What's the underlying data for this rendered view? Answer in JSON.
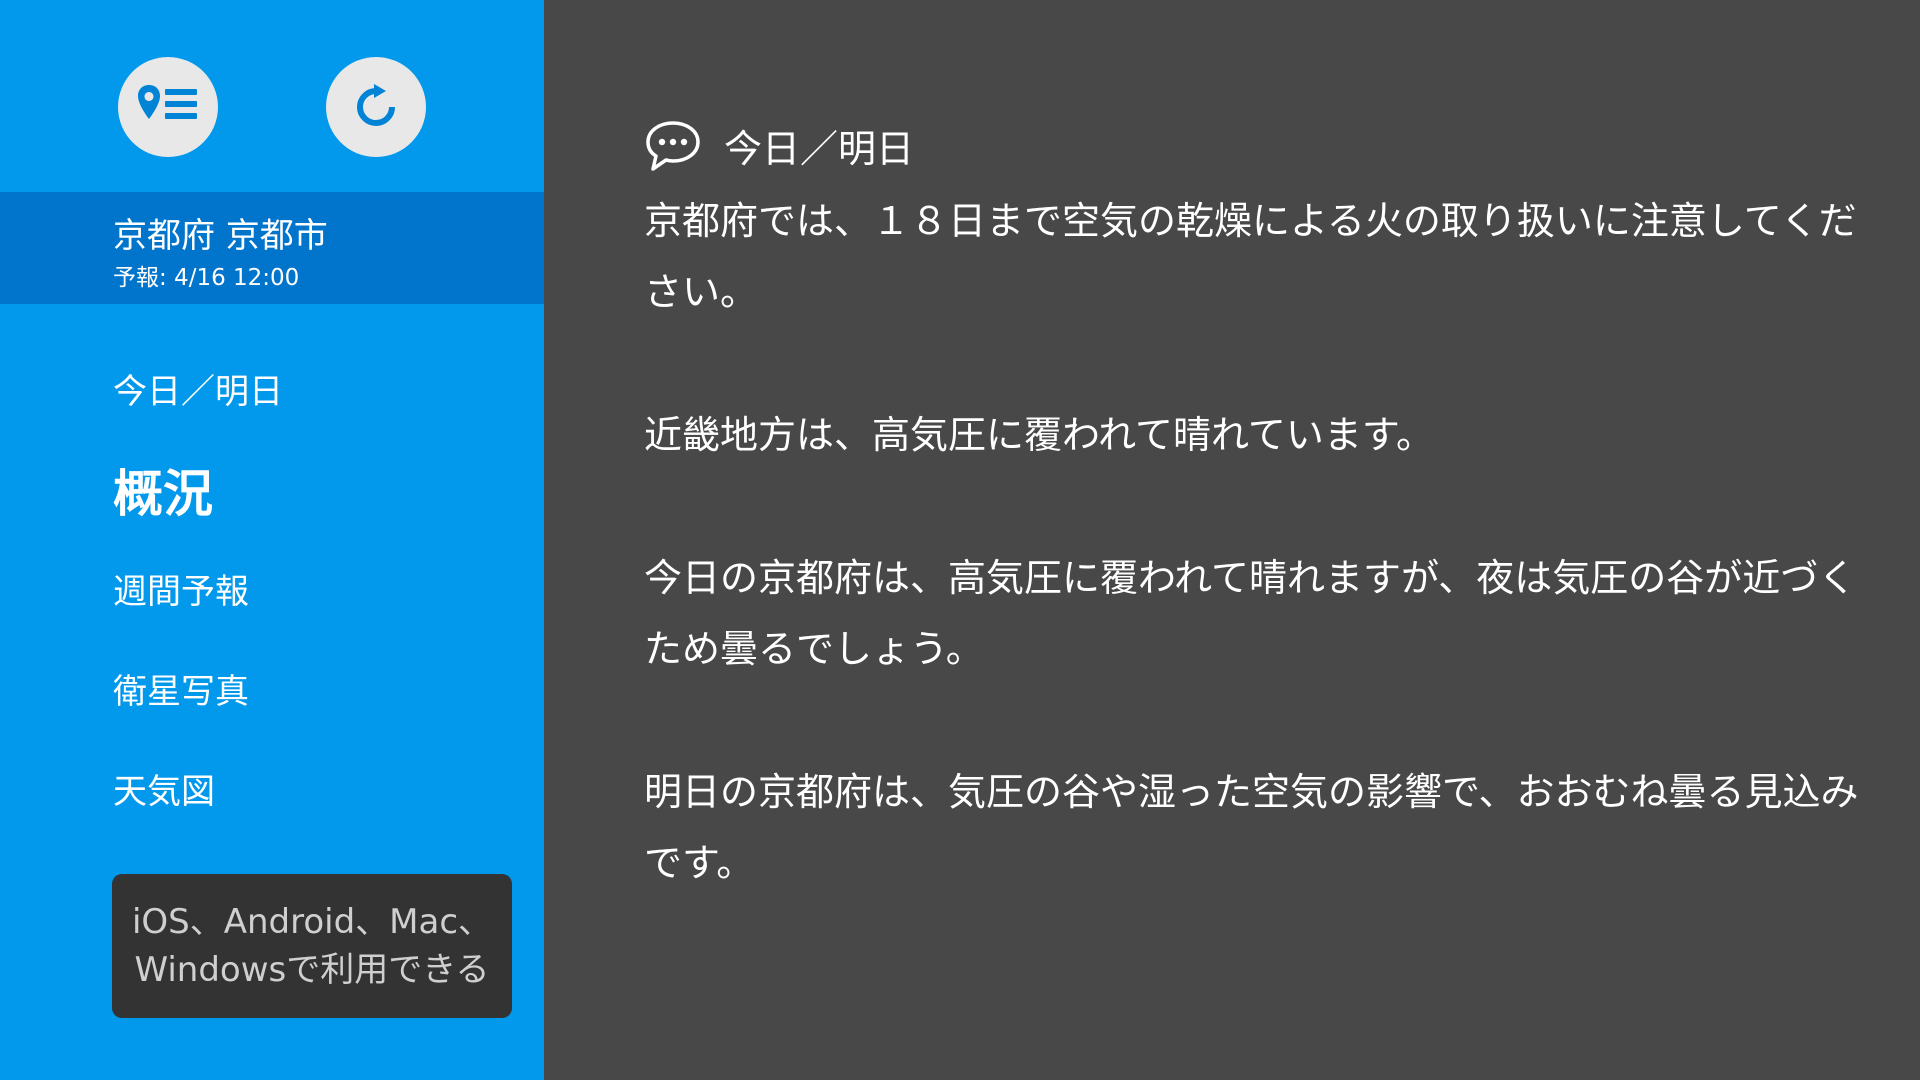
{
  "toolbar": {
    "locations_icon": "location-list-icon",
    "refresh_icon": "refresh-icon"
  },
  "location": {
    "name": "京都府 京都市",
    "forecast_time": "予報: 4/16 12:00"
  },
  "nav": {
    "items": [
      {
        "label": "今日／明日",
        "active": false
      },
      {
        "label": "概況",
        "active": true
      },
      {
        "label": "週間予報",
        "active": false
      },
      {
        "label": "衛星写真",
        "active": false
      },
      {
        "label": "天気図",
        "active": false
      }
    ]
  },
  "promo": {
    "line1": "iOS、Android、Mac、",
    "line2": "Windowsで利用できる"
  },
  "content": {
    "header_icon": "speech-bubble-icon",
    "section_title": "今日／明日",
    "paragraphs": [
      "京都府では、１８日まで空気の乾燥による火の取り扱いに注意してください。",
      "近畿地方は、高気圧に覆われて晴れています。",
      "今日の京都府は、高気圧に覆われて晴れますが、夜は気圧の谷が近づくため曇るでしょう。",
      "明日の京都府は、気圧の谷や湿った空気の影響で、おおむね曇る見込みです。"
    ]
  },
  "colors": {
    "sidebar": "#0299ec",
    "location_box": "#0174cc",
    "content_bg": "#484848",
    "promo_bg": "#333333",
    "icon_blue": "#0183d6"
  }
}
